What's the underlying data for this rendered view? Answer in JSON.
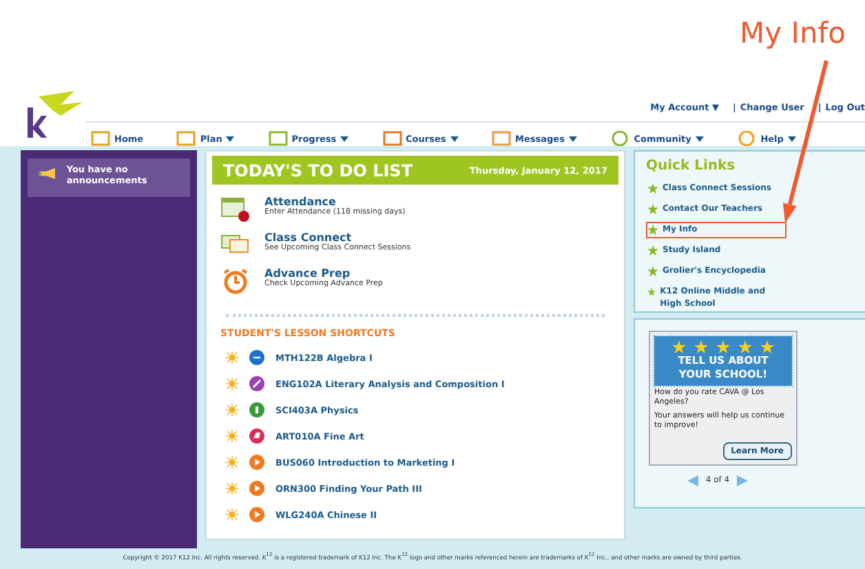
{
  "annotation": {
    "label": "My Info"
  },
  "header": {
    "account_links": [
      "My Account ▼",
      "Change User",
      "Log Out"
    ],
    "separator": "|",
    "nav": [
      {
        "label": "Home",
        "kind": "home",
        "has_menu": false
      },
      {
        "label": "Plan",
        "kind": "plan",
        "has_menu": true
      },
      {
        "label": "Progress",
        "kind": "progress",
        "has_menu": true
      },
      {
        "label": "Courses",
        "kind": "courses",
        "has_menu": true
      },
      {
        "label": "Messages",
        "kind": "messages",
        "has_menu": true
      },
      {
        "label": "Community",
        "kind": "community",
        "has_menu": true
      },
      {
        "label": "Help",
        "kind": "help",
        "has_menu": true
      }
    ]
  },
  "sidebar": {
    "announcement": "You have no announcements"
  },
  "todo": {
    "title": "TODAY'S TO DO LIST",
    "date": "Thursday, January 12, 2017",
    "tasks": [
      {
        "kind": "attendance",
        "title": "Attendance",
        "subtitle": "Enter Attendance (118 missing days)"
      },
      {
        "kind": "chat",
        "title": "Class Connect",
        "subtitle": "See Upcoming Class Connect Sessions"
      },
      {
        "kind": "clock",
        "title": "Advance Prep",
        "subtitle": "Check Upcoming Advance Prep"
      }
    ],
    "shortcuts_title": "STUDENT'S LESSON SHORTCUTS",
    "shortcuts": [
      {
        "label": "MTH122B Algebra I",
        "kind": "divide",
        "color": "#1f6fd0"
      },
      {
        "label": "ENG102A Literary Analysis and Composition I",
        "kind": "pencil",
        "color": "#9b3fb5"
      },
      {
        "label": "SCI403A Physics",
        "kind": "flask",
        "color": "#3a9a3a"
      },
      {
        "label": "ART010A Fine Art",
        "kind": "brush",
        "color": "#d9305a"
      },
      {
        "label": "BUS060 Introduction to Marketing I",
        "kind": "play",
        "color": "#f07a20"
      },
      {
        "label": "ORN300 Finding Your Path III",
        "kind": "play",
        "color": "#f07a20"
      },
      {
        "label": "WLG240A Chinese II",
        "kind": "play",
        "color": "#f07a20"
      }
    ]
  },
  "quick_links": {
    "title": "Quick Links",
    "items": [
      {
        "label": "Class Connect Sessions",
        "highlighted": false
      },
      {
        "label": "Contact Our Teachers",
        "highlighted": false
      },
      {
        "label": "My Info",
        "highlighted": true
      },
      {
        "label": "Study Island",
        "highlighted": false
      },
      {
        "label": "Grolier's Encyclopedia",
        "highlighted": false
      },
      {
        "label": "K12 Online Middle and High School",
        "highlighted": false
      }
    ]
  },
  "survey": {
    "stars": 5,
    "banner": [
      "TELL US ABOUT",
      "YOUR SCHOOL!"
    ],
    "question": "How do you rate CAVA @ Los Angeles?",
    "text": "Your answers will help us continue to improve!",
    "button": "Learn More",
    "pager": "4 of 4"
  },
  "footer": "Copyright © 2017 K12 Inc. All rights reserved. K$^{12}$ is a registered trademark of K12 Inc. The K$^{12}$ logo and other marks referenced herein are trademarks of K$^{12}$ Inc., and other marks are owned by third parties."
}
